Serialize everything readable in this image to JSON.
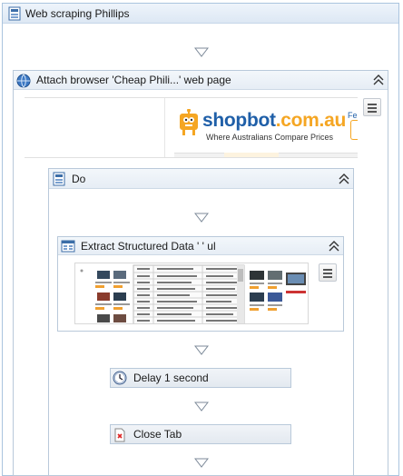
{
  "sequence": {
    "title": "Web scraping Phillips"
  },
  "attach_browser": {
    "title": "Attach browser 'Cheap Phili...' web page",
    "preview": {
      "brand_main": "shopbot",
      "brand_tld": ".com.au",
      "tagline": "Where Australians Compare Prices",
      "corner_text": "Fe"
    }
  },
  "do": {
    "title": "Do"
  },
  "extract": {
    "title": "Extract Structured Data ' ' ul"
  },
  "delay": {
    "title": "Delay 1 second"
  },
  "close_tab": {
    "title": "Close Tab"
  },
  "colors": {
    "accent_orange": "#f5a623",
    "brand_blue": "#1f5fa8",
    "border": "#b9c9da"
  },
  "icons": [
    "sequence-icon",
    "globe-icon",
    "do-icon",
    "extract-data-icon",
    "clock-icon",
    "close-tab-icon",
    "collapse-icon",
    "menu-icon",
    "arrow-down-icon"
  ]
}
